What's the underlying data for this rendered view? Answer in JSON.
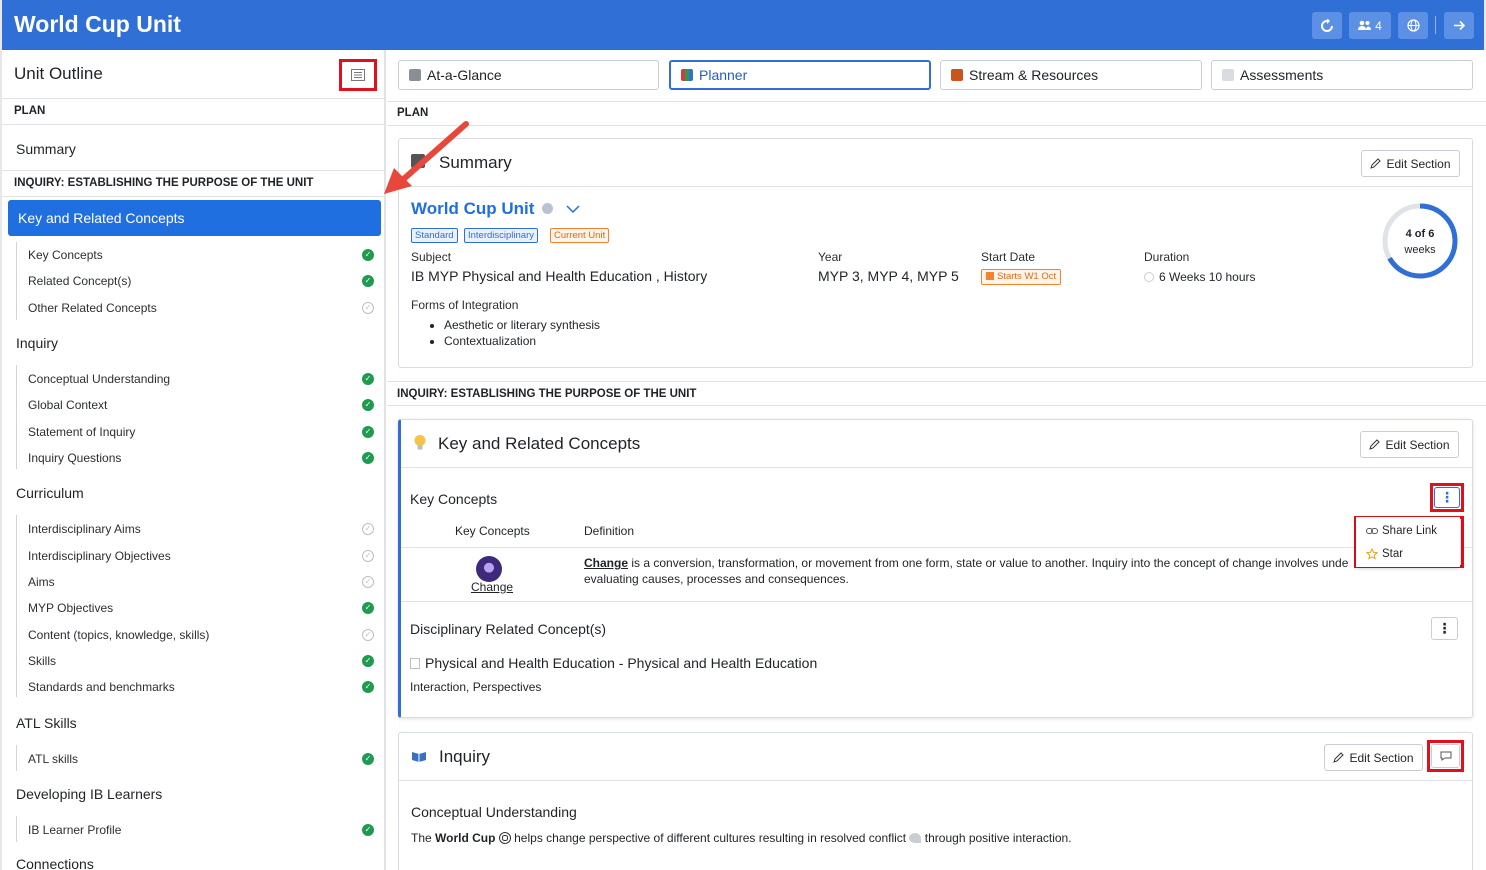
{
  "app": {
    "title": "World Cup Unit",
    "users_count": "4"
  },
  "sidebar": {
    "title": "Unit Outline",
    "sections": {
      "plan": "PLAN",
      "inquiry": "INQUIRY: ESTABLISHING THE PURPOSE OF THE UNIT"
    },
    "summary": "Summary",
    "active": "Key and Related Concepts",
    "kc_items": [
      {
        "label": "Key Concepts",
        "done": true
      },
      {
        "label": "Related Concept(s)",
        "done": true
      },
      {
        "label": "Other Related Concepts",
        "done": false
      }
    ],
    "groups": {
      "inquiry": "Inquiry",
      "curriculum": "Curriculum",
      "atl": "ATL Skills",
      "learners": "Developing IB Learners",
      "connections": "Connections"
    },
    "inquiry_items": [
      {
        "label": "Conceptual Understanding",
        "done": true
      },
      {
        "label": "Global Context",
        "done": true
      },
      {
        "label": "Statement of Inquiry",
        "done": true
      },
      {
        "label": "Inquiry Questions",
        "done": true
      }
    ],
    "curriculum_items": [
      {
        "label": "Interdisciplinary Aims",
        "done": false
      },
      {
        "label": "Interdisciplinary Objectives",
        "done": false
      },
      {
        "label": "Aims",
        "done": false
      },
      {
        "label": "MYP Objectives",
        "done": true
      },
      {
        "label": "Content (topics, knowledge, skills)",
        "done": false
      },
      {
        "label": "Skills",
        "done": true
      },
      {
        "label": "Standards and benchmarks",
        "done": true
      }
    ],
    "atl_items": [
      {
        "label": "ATL skills",
        "done": true
      }
    ],
    "learner_items": [
      {
        "label": "IB Learner Profile",
        "done": true
      }
    ]
  },
  "tabs": [
    {
      "label": "At-a-Glance",
      "active": false
    },
    {
      "label": "Planner",
      "active": true
    },
    {
      "label": "Stream & Resources",
      "active": false
    },
    {
      "label": "Assessments",
      "active": false
    }
  ],
  "main": {
    "plan_label": "PLAN",
    "inquiry_label": "INQUIRY: ESTABLISHING THE PURPOSE OF THE UNIT",
    "edit_label": "Edit Section",
    "summary": {
      "title": "Summary",
      "unit_name": "World Cup Unit",
      "badges": [
        "Standard",
        "Interdisciplinary",
        "Current Unit"
      ],
      "subject_label": "Subject",
      "subject": "IB MYP Physical and Health Education , History",
      "year_label": "Year",
      "year": "MYP 3, MYP 4, MYP 5",
      "start_label": "Start Date",
      "start": "Starts W1 Oct",
      "duration_label": "Duration",
      "duration": "6 Weeks 10 hours",
      "progress": {
        "current": 4,
        "total": 6,
        "text": "4 of 6",
        "unit": "weeks"
      },
      "integration_label": "Forms of Integration",
      "integration": [
        "Aesthetic or literary synthesis",
        "Contextualization"
      ]
    },
    "krc": {
      "title": "Key and Related Concepts",
      "kc_heading": "Key Concepts",
      "col_concepts": "Key Concepts",
      "col_definition": "Definition",
      "concept": "Change",
      "definition_term": "Change",
      "definition_line1": " is a conversion, transformation, or movement from one form, state or value to another. Inquiry into the concept of change involves unde",
      "definition_line2": "evaluating causes, processes and consequences.",
      "menu": {
        "share": "Share Link",
        "star": "Star"
      },
      "drc_heading": "Disciplinary Related Concept(s)",
      "drc_subject": "Physical and Health Education - Physical and Health Education",
      "drc_values": "Interaction, Perspectives"
    },
    "inquiry": {
      "title": "Inquiry",
      "cu_heading": "Conceptual Understanding",
      "cu_pre": "The ",
      "cu_bold": "World Cup",
      "cu_mid": " helps change perspective of different cultures resulting in resolved conflict ",
      "cu_post": " through positive interaction."
    }
  }
}
